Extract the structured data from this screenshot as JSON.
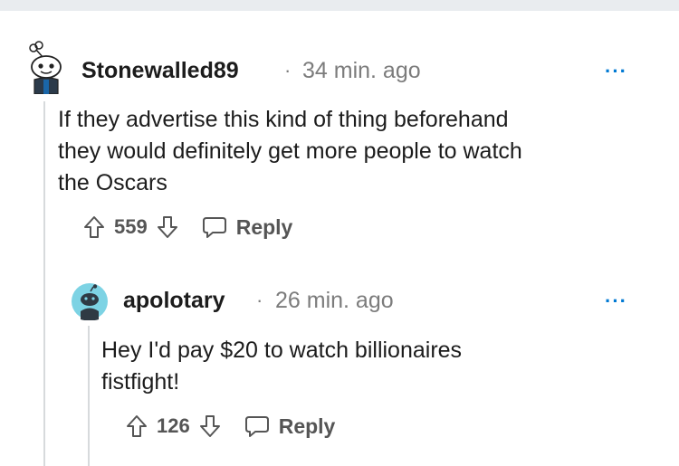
{
  "comments": [
    {
      "username": "Stonewalled89",
      "separator": "·",
      "time": "34 min. ago",
      "more": "···",
      "body_lines": [
        "If they advertise this kind of thing beforehand",
        "they would definitely get more people to watch",
        "the Oscars"
      ],
      "score": "559",
      "reply_label": "Reply",
      "avatar_icon": "snoo-avatar-icon"
    },
    {
      "username": "apolotary",
      "separator": "·",
      "time": "26 min. ago",
      "more": "···",
      "body_lines": [
        "Hey I'd pay $20 to watch billionaires",
        "fistfight!"
      ],
      "score": "126",
      "reply_label": "Reply",
      "avatar_icon": "snoo-avatar-icon"
    }
  ],
  "colors": {
    "accent": "#0079d3",
    "avatar_teal": "#7dd3e4",
    "muted": "#7c7c7c",
    "thread_line": "#d7dadc"
  }
}
